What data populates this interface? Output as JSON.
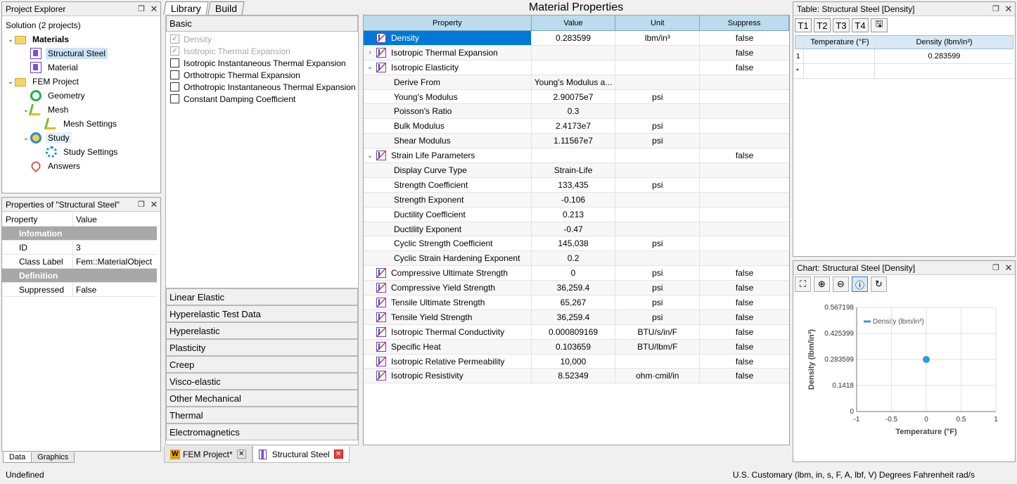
{
  "project_explorer": {
    "title": "Project Explorer",
    "items": [
      {
        "label": "Solution (2 projects)",
        "level": 0,
        "arrow": "",
        "icon": ""
      },
      {
        "label": "Materials",
        "level": 1,
        "arrow": "⌄",
        "icon": "folder",
        "bold": true
      },
      {
        "label": "Structural Steel",
        "level": 2,
        "arrow": "",
        "icon": "material",
        "selected": true
      },
      {
        "label": "Material",
        "level": 2,
        "arrow": "",
        "icon": "material"
      },
      {
        "label": "FEM Project",
        "level": 1,
        "arrow": "⌄",
        "icon": "folder"
      },
      {
        "label": "Geometry",
        "level": 2,
        "arrow": "",
        "icon": "geometry"
      },
      {
        "label": "Mesh",
        "level": 2,
        "arrow": "⌄",
        "icon": "mesh"
      },
      {
        "label": "Mesh Settings",
        "level": 3,
        "arrow": "",
        "icon": "mesh"
      },
      {
        "label": "Study",
        "level": 2,
        "arrow": "⌄",
        "icon": "study",
        "hover": true
      },
      {
        "label": "Study Settings",
        "level": 3,
        "arrow": "",
        "icon": "settings"
      },
      {
        "label": "Answers",
        "level": 2,
        "arrow": "",
        "icon": "answers"
      }
    ]
  },
  "properties_panel": {
    "title": "Properties of \"Structural Steel\"",
    "header": {
      "property": "Property",
      "value": "Value"
    },
    "rows": [
      {
        "type": "grp",
        "property": "Infomation",
        "value": ""
      },
      {
        "type": "item",
        "property": "ID",
        "value": "3"
      },
      {
        "type": "item",
        "property": "Class Label",
        "value": "Fem::MaterialObject"
      },
      {
        "type": "grp",
        "property": "Definition",
        "value": ""
      },
      {
        "type": "item",
        "property": "Suppressed",
        "value": "False"
      }
    ]
  },
  "left_tabs": [
    "Data",
    "Graphics"
  ],
  "library": {
    "tabs": [
      "Library",
      "Build"
    ],
    "basic_header": "Basic",
    "basic_items": [
      {
        "label": "Density",
        "checked": true,
        "disabled": true
      },
      {
        "label": "Isotropic Thermal Expansion",
        "checked": true,
        "disabled": true
      },
      {
        "label": "Isotropic Instantaneous Thermal Expansion",
        "checked": false,
        "disabled": false
      },
      {
        "label": "Orthotropic Thermal Expansion",
        "checked": false,
        "disabled": false
      },
      {
        "label": "Orthotropic Instantaneous Thermal Expansion",
        "checked": false,
        "disabled": false
      },
      {
        "label": "Constant Damping Coefficient",
        "checked": false,
        "disabled": false
      }
    ],
    "categories": [
      "Linear Elastic",
      "Hyperelastic Test Data",
      "Hyperelastic",
      "Plasticity",
      "Creep",
      "Visco-elastic",
      "Other Mechanical",
      "Thermal",
      "Electromagnetics"
    ]
  },
  "material_properties": {
    "title": "Material Properties",
    "columns": [
      "Property",
      "Value",
      "Unit",
      "Suppress"
    ],
    "rows": [
      {
        "property": "Density",
        "value": "0.283599",
        "unit": "lbm/in³",
        "suppress": "false",
        "icon": true,
        "expand": "",
        "child": false,
        "selected": true
      },
      {
        "property": "Isotropic Thermal Expansion",
        "value": "",
        "unit": "",
        "suppress": "false",
        "icon": true,
        "expand": "›",
        "child": false
      },
      {
        "property": "Isotropic Elasticity",
        "value": "",
        "unit": "",
        "suppress": "false",
        "icon": true,
        "expand": "⌄",
        "child": false
      },
      {
        "property": "Derive From",
        "value": "Young's Modulus a...",
        "unit": "",
        "suppress": "",
        "icon": false,
        "expand": "",
        "child": true
      },
      {
        "property": "Young's Modulus",
        "value": "2.90075e7",
        "unit": "psi",
        "suppress": "",
        "icon": false,
        "expand": "",
        "child": true
      },
      {
        "property": "Poisson's Ratio",
        "value": "0.3",
        "unit": "",
        "suppress": "",
        "icon": false,
        "expand": "",
        "child": true
      },
      {
        "property": "Bulk Modulus",
        "value": "2.4173e7",
        "unit": "psi",
        "suppress": "",
        "icon": false,
        "expand": "",
        "child": true
      },
      {
        "property": "Shear Modulus",
        "value": "1.11567e7",
        "unit": "psi",
        "suppress": "",
        "icon": false,
        "expand": "",
        "child": true
      },
      {
        "property": "Strain Life Parameters",
        "value": "",
        "unit": "",
        "suppress": "false",
        "icon": true,
        "expand": "⌄",
        "child": false
      },
      {
        "property": "Display Curve Type",
        "value": "Strain-Life",
        "unit": "",
        "suppress": "",
        "icon": false,
        "expand": "",
        "child": true
      },
      {
        "property": "Strength Coefficient",
        "value": "133,435",
        "unit": "psi",
        "suppress": "",
        "icon": false,
        "expand": "",
        "child": true
      },
      {
        "property": "Strength Exponent",
        "value": "-0.106",
        "unit": "",
        "suppress": "",
        "icon": false,
        "expand": "",
        "child": true
      },
      {
        "property": "Ductility Coefficient",
        "value": "0.213",
        "unit": "",
        "suppress": "",
        "icon": false,
        "expand": "",
        "child": true
      },
      {
        "property": "Ductility Exponent",
        "value": "-0.47",
        "unit": "",
        "suppress": "",
        "icon": false,
        "expand": "",
        "child": true
      },
      {
        "property": "Cyclic Strength Coefficient",
        "value": "145,038",
        "unit": "psi",
        "suppress": "",
        "icon": false,
        "expand": "",
        "child": true
      },
      {
        "property": "Cyclic Strain Hardening Exponent",
        "value": "0.2",
        "unit": "",
        "suppress": "",
        "icon": false,
        "expand": "",
        "child": true
      },
      {
        "property": "Compressive Ultimate Strength",
        "value": "0",
        "unit": "psi",
        "suppress": "false",
        "icon": true,
        "expand": "",
        "child": false
      },
      {
        "property": "Compressive Yield Strength",
        "value": "36,259.4",
        "unit": "psi",
        "suppress": "false",
        "icon": true,
        "expand": "",
        "child": false
      },
      {
        "property": "Tensile Ultimate Strength",
        "value": "65,267",
        "unit": "psi",
        "suppress": "false",
        "icon": true,
        "expand": "",
        "child": false
      },
      {
        "property": "Tensile Yield Strength",
        "value": "36,259.4",
        "unit": "psi",
        "suppress": "false",
        "icon": true,
        "expand": "",
        "child": false
      },
      {
        "property": "Isotropic Thermal Conductivity",
        "value": "0.000809169",
        "unit": "BTU/s/in/F",
        "suppress": "false",
        "icon": true,
        "expand": "",
        "child": false
      },
      {
        "property": "Specific Heat",
        "value": "0.103659",
        "unit": "BTU/lbm/F",
        "suppress": "false",
        "icon": true,
        "expand": "",
        "child": false
      },
      {
        "property": "Isotropic Relative Permeability",
        "value": "10,000",
        "unit": "",
        "suppress": "false",
        "icon": true,
        "expand": "",
        "child": false
      },
      {
        "property": "Isotropic Resistivity",
        "value": "8.52349",
        "unit": "ohm·cmil/in",
        "suppress": "false",
        "icon": true,
        "expand": "",
        "child": false
      }
    ]
  },
  "table_panel": {
    "title": "Table: Structural Steel [Density]",
    "buttons": [
      "T1",
      "T2",
      "T3",
      "T4"
    ],
    "col1": "Temperature (°F)",
    "col2": "Density (lbm/in³)",
    "rows": [
      {
        "rn": "1",
        "t": "",
        "d": "0.283599"
      },
      {
        "rn": "*",
        "t": "",
        "d": ""
      }
    ]
  },
  "chart_panel": {
    "title": "Chart: Structural Steel [Density]"
  },
  "chart_data": {
    "type": "scatter",
    "legend": "Density (lbm/in³)",
    "legend_position": "top",
    "xlabel": "Temperature (°F)",
    "ylabel": "Density (lbm/in³)",
    "xlim": [
      -1,
      1
    ],
    "ylim": [
      0,
      0.567198
    ],
    "x_ticks": [
      "-1",
      "-0.5",
      "0",
      "0.5",
      "1"
    ],
    "y_ticks": [
      "0",
      "0.1418",
      "0.283599",
      "0.425399",
      "0.567198"
    ],
    "points": [
      {
        "x": 0,
        "y": 0.283599
      }
    ],
    "color": "#2e9be0",
    "grid": true
  },
  "doc_tabs": [
    {
      "label": "FEM Project*",
      "active": false
    },
    {
      "label": "Structural Steel",
      "active": true
    }
  ],
  "status": {
    "left": "Undefined",
    "right": "U.S. Customary (lbm, in, s, F, A, lbf, V)  Degrees  Fahrenheit  rad/s"
  }
}
